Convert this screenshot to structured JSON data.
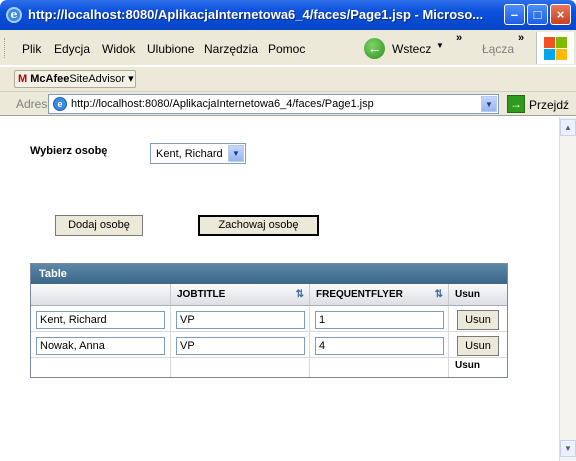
{
  "window": {
    "title": "http://localhost:8080/AplikacjaInternetowa6_4/faces/Page1.jsp - Microso...",
    "buttons": {
      "minimize": "–",
      "maximize": "□",
      "close": "×"
    }
  },
  "menubar": {
    "items": [
      "Plik",
      "Edycja",
      "Widok",
      "Ulubione",
      "Narzędzia",
      "Pomoc"
    ],
    "back_label": "Wstecz",
    "chevron": "»",
    "links_label": "Łącza"
  },
  "mcafee": {
    "brand": "McAfee",
    "label": "SiteAdvisor"
  },
  "address": {
    "label": "Adres",
    "url": "http://localhost:8080/AplikacjaInternetowa6_4/faces/Page1.jsp",
    "go_label": "Przejdź"
  },
  "page": {
    "pick_label": "Wybierz osobę",
    "selected_person": "Kent, Richard",
    "add_button": "Dodaj osobę",
    "save_button": "Zachowaj osobę"
  },
  "table": {
    "title": "Table",
    "columns": [
      "",
      "JOBTITLE",
      "FREQUENTFLYER",
      "Usun"
    ],
    "rows": [
      {
        "name": "Kent, Richard",
        "jobtitle": "VP",
        "frequentflyer": "1",
        "action": "Usun"
      },
      {
        "name": "Nowak, Anna",
        "jobtitle": "VP",
        "frequentflyer": "4",
        "action": "Usun"
      }
    ],
    "footer": "Usun"
  },
  "icons": {
    "window": "ie-icon",
    "back": "back-arrow-icon",
    "windows_logo": "windows-logo-icon",
    "page": "page-icon",
    "go": "go-arrow-icon",
    "sort": "sort-icon"
  }
}
